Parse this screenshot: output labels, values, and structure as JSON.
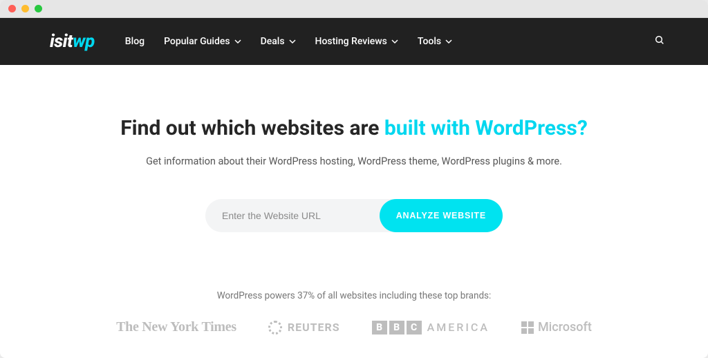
{
  "logo": {
    "part1": "isit",
    "part2": "wp"
  },
  "nav": {
    "items": [
      {
        "label": "Blog",
        "dropdown": false
      },
      {
        "label": "Popular Guides",
        "dropdown": true
      },
      {
        "label": "Deals",
        "dropdown": true
      },
      {
        "label": "Hosting Reviews",
        "dropdown": true
      },
      {
        "label": "Tools",
        "dropdown": true
      }
    ]
  },
  "hero": {
    "headline_plain": "Find out which websites are ",
    "headline_accent": "built with WordPress?",
    "subtitle": "Get information about their WordPress hosting, WordPress theme, WordPress plugins & more.",
    "input_placeholder": "Enter the Website URL",
    "input_value": "",
    "button_label": "ANALYZE WEBSITE"
  },
  "stats": "WordPress powers 37% of all websites including these top brands:",
  "brands": {
    "nyt": "The New York Times",
    "reuters": "REUTERS",
    "bbc_letters": [
      "B",
      "B",
      "C"
    ],
    "bbc_america": "AMERICA",
    "microsoft": "Microsoft"
  },
  "colors": {
    "accent": "#00d7ef",
    "nav_bg": "#212121"
  }
}
